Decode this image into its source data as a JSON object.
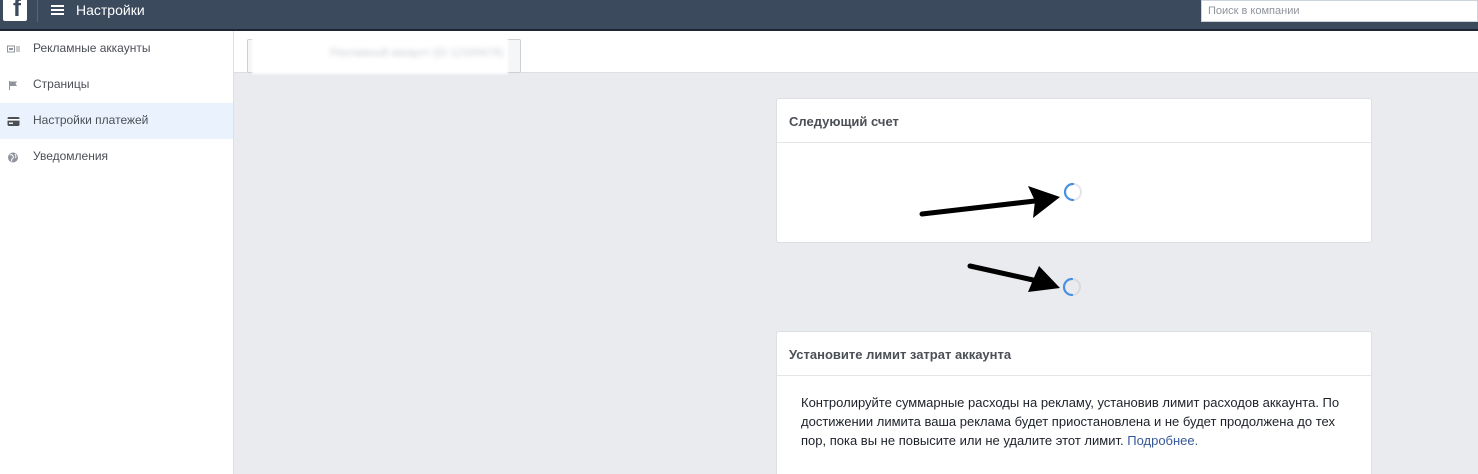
{
  "header": {
    "logo_letter": "f",
    "title": "Настройки",
    "search_placeholder": "Поиск в компании"
  },
  "sidebar": {
    "items": [
      {
        "label": "Рекламные аккаунты",
        "icon": "ad-accounts-icon",
        "active": false
      },
      {
        "label": "Страницы",
        "icon": "flag-icon",
        "active": false
      },
      {
        "label": "Настройки платежей",
        "icon": "credit-card-icon",
        "active": true
      },
      {
        "label": "Уведомления",
        "icon": "globe-icon",
        "active": false
      }
    ]
  },
  "account_selector": {
    "value": "Рекламный аккаунт (ID 12345678)",
    "blurred": true
  },
  "next_invoice_card": {
    "title": "Следующий счет",
    "loading": true
  },
  "spend_limit_card": {
    "title": "Установите лимит затрат аккаунта",
    "description": "Контролируйте суммарные расходы на рекламу, установив лимит расходов аккаунта. По достижении лимита ваша реклама будет приостановлена и не будет продолжена до тех пор, пока вы не повысите или не удалите этот лимит.",
    "learn_more": "Подробнее."
  },
  "colors": {
    "topbar": "#3b4a5c",
    "active_item": "#eaf3fd",
    "spinner": "#4a90e2",
    "link": "#365899",
    "page_bg": "#e9ebee"
  }
}
